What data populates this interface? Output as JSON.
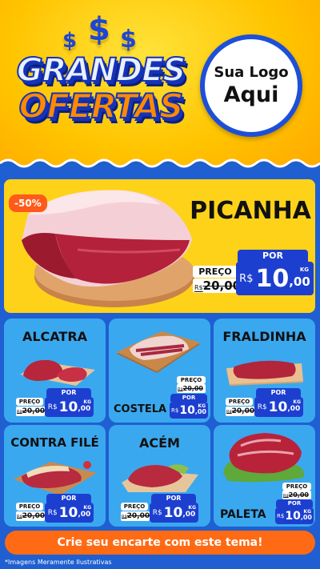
{
  "header": {
    "dollar_signs": [
      "$",
      "$",
      "$"
    ],
    "title_line1": "GRANDES",
    "title_line2": "OFERTAS",
    "logo_line1": "Sua Logo",
    "logo_line2": "Aqui"
  },
  "colors": {
    "yellow": "#ffd21a",
    "blue_bg": "#1f5fd1",
    "card_blue": "#3aa8ef",
    "price_blue": "#1d3fd0",
    "orange": "#ff6a14"
  },
  "featured": {
    "discount": "-50%",
    "name": "PICANHA",
    "preco_label": "PREÇO",
    "old_price_currency": "R$",
    "old_price": "20,00",
    "por_label": "POR",
    "new_price_currency": "R$",
    "new_price_int": "10",
    "new_price_dec": ",00",
    "unit": "KG"
  },
  "products": [
    {
      "name": "ALCATRA",
      "preco_label": "PREÇO",
      "old_currency": "R$",
      "old_price": "20,00",
      "por_label": "POR",
      "currency": "R$",
      "int": "10",
      "dec": ",00",
      "unit": "KG"
    },
    {
      "name": "COSTELA",
      "preco_label": "PREÇO",
      "old_currency": "R$",
      "old_price": "20,00",
      "por_label": "POR",
      "currency": "R$",
      "int": "10",
      "dec": ",00",
      "unit": "KG"
    },
    {
      "name": "FRALDINHA",
      "preco_label": "PREÇO",
      "old_currency": "R$",
      "old_price": "20,00",
      "por_label": "POR",
      "currency": "R$",
      "int": "10",
      "dec": ",00",
      "unit": "KG"
    },
    {
      "name": "CONTRA FILÉ",
      "preco_label": "PREÇO",
      "old_currency": "R$",
      "old_price": "20,00",
      "por_label": "POR",
      "currency": "R$",
      "int": "10",
      "dec": ",00",
      "unit": "KG"
    },
    {
      "name": "ACÉM",
      "preco_label": "PREÇO",
      "old_currency": "R$",
      "old_price": "20,00",
      "por_label": "POR",
      "currency": "R$",
      "int": "10",
      "dec": ",00",
      "unit": "KG"
    },
    {
      "name": "PALETA",
      "preco_label": "PREÇO",
      "old_currency": "R$",
      "old_price": "20,00",
      "por_label": "POR",
      "currency": "R$",
      "int": "10",
      "dec": ",00",
      "unit": "KG"
    }
  ],
  "footer": {
    "cta": "Crie seu encarte com este tema!",
    "note": "*Imagens Meramente Ilustrativas"
  }
}
